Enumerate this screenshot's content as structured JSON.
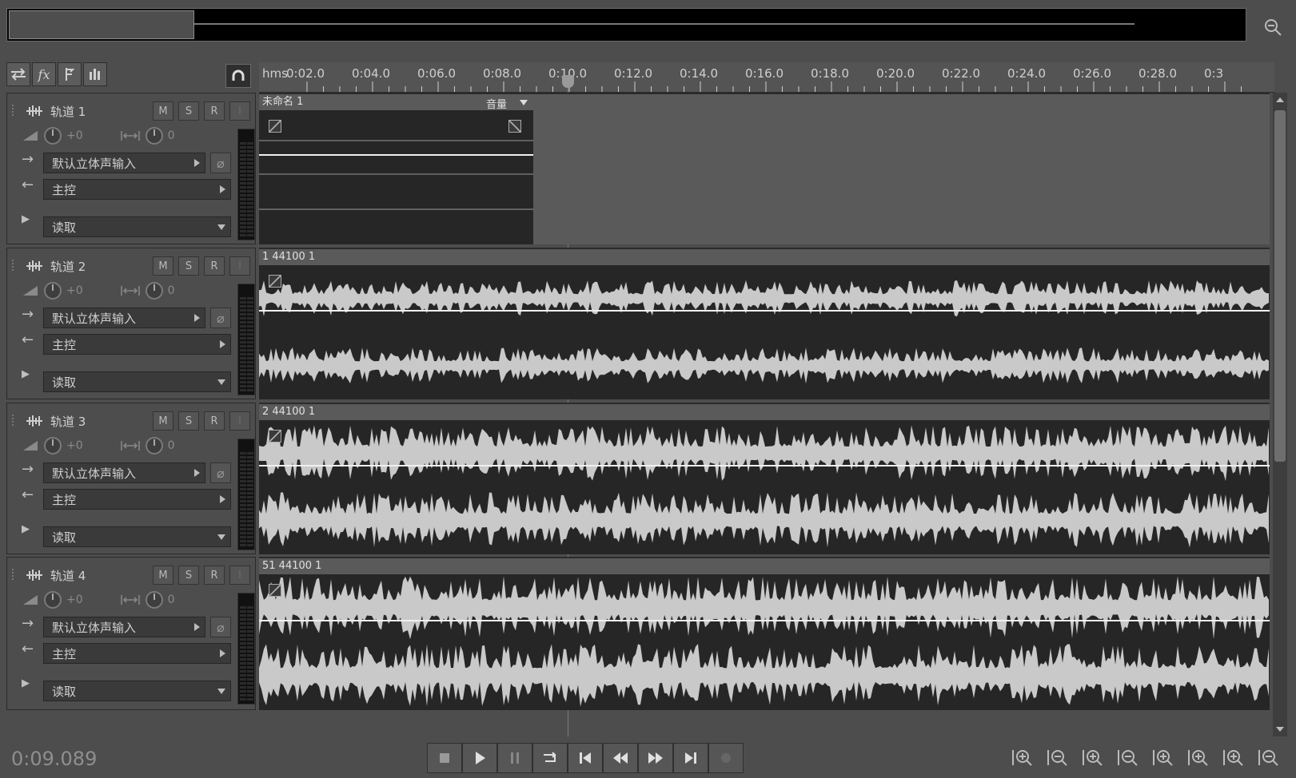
{
  "toolbar": {
    "icons": [
      "swap-icon",
      "fx-icon",
      "send-icon",
      "eq-icon"
    ],
    "snap_icon": "headphone-magnet-icon"
  },
  "ruler": {
    "unit": "hms",
    "labels": [
      "0:02.0",
      "0:04.0",
      "0:06.0",
      "0:08.0",
      "0:10.0",
      "0:12.0",
      "0:14.0",
      "0:16.0",
      "0:18.0",
      "0:20.0",
      "0:22.0",
      "0:24.0",
      "0:26.0",
      "0:28.0",
      "0:3"
    ]
  },
  "tracks": [
    {
      "name": "轨道 1",
      "m": "M",
      "s": "S",
      "r": "R",
      "i": "I",
      "volume": "+0",
      "pan": "0",
      "input": "默认立体声输入",
      "output": "主控",
      "automation": "读取",
      "clip_title": "未命名 1",
      "clip_param": "音量"
    },
    {
      "name": "轨道 2",
      "m": "M",
      "s": "S",
      "r": "R",
      "i": "I",
      "volume": "+0",
      "pan": "0",
      "input": "默认立体声输入",
      "output": "主控",
      "automation": "读取",
      "clip_title": "1 44100 1"
    },
    {
      "name": "轨道 3",
      "m": "M",
      "s": "S",
      "r": "R",
      "i": "I",
      "volume": "+0",
      "pan": "0",
      "input": "默认立体声输入",
      "output": "主控",
      "automation": "读取",
      "clip_title": "2 44100 1"
    },
    {
      "name": "轨道 4",
      "m": "M",
      "s": "S",
      "r": "R",
      "i": "I",
      "volume": "+0",
      "pan": "0",
      "input": "默认立体声输入",
      "output": "主控",
      "automation": "读取",
      "clip_title": "51 44100 1"
    }
  ],
  "playhead": {
    "time": "0:09.089"
  },
  "transport": {
    "buttons": [
      "stop-icon",
      "play-icon",
      "pause-icon",
      "loop-icon",
      "go-start-icon",
      "rewind-icon",
      "fast-forward-icon",
      "go-end-icon",
      "record-icon"
    ]
  },
  "zoom": {
    "buttons": [
      "zoom-in-amplitude-icon",
      "zoom-out-amplitude-icon",
      "zoom-in-time-icon",
      "zoom-out-time-icon",
      "zoom-full-icon",
      "zoom-in-left-icon",
      "zoom-in-right-icon",
      "zoom-selection-icon"
    ]
  }
}
